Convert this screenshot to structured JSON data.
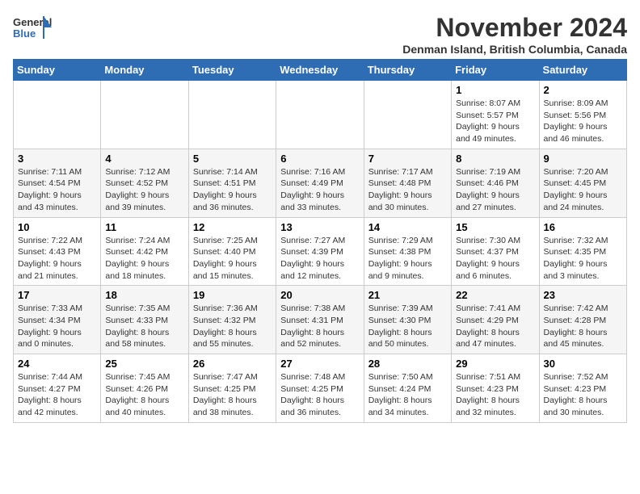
{
  "logo": {
    "line1": "General",
    "line2": "Blue"
  },
  "title": "November 2024",
  "subtitle": "Denman Island, British Columbia, Canada",
  "weekdays": [
    "Sunday",
    "Monday",
    "Tuesday",
    "Wednesday",
    "Thursday",
    "Friday",
    "Saturday"
  ],
  "weeks": [
    [
      {
        "day": "",
        "detail": ""
      },
      {
        "day": "",
        "detail": ""
      },
      {
        "day": "",
        "detail": ""
      },
      {
        "day": "",
        "detail": ""
      },
      {
        "day": "",
        "detail": ""
      },
      {
        "day": "1",
        "detail": "Sunrise: 8:07 AM\nSunset: 5:57 PM\nDaylight: 9 hours and 49 minutes."
      },
      {
        "day": "2",
        "detail": "Sunrise: 8:09 AM\nSunset: 5:56 PM\nDaylight: 9 hours and 46 minutes."
      }
    ],
    [
      {
        "day": "3",
        "detail": "Sunrise: 7:11 AM\nSunset: 4:54 PM\nDaylight: 9 hours and 43 minutes."
      },
      {
        "day": "4",
        "detail": "Sunrise: 7:12 AM\nSunset: 4:52 PM\nDaylight: 9 hours and 39 minutes."
      },
      {
        "day": "5",
        "detail": "Sunrise: 7:14 AM\nSunset: 4:51 PM\nDaylight: 9 hours and 36 minutes."
      },
      {
        "day": "6",
        "detail": "Sunrise: 7:16 AM\nSunset: 4:49 PM\nDaylight: 9 hours and 33 minutes."
      },
      {
        "day": "7",
        "detail": "Sunrise: 7:17 AM\nSunset: 4:48 PM\nDaylight: 9 hours and 30 minutes."
      },
      {
        "day": "8",
        "detail": "Sunrise: 7:19 AM\nSunset: 4:46 PM\nDaylight: 9 hours and 27 minutes."
      },
      {
        "day": "9",
        "detail": "Sunrise: 7:20 AM\nSunset: 4:45 PM\nDaylight: 9 hours and 24 minutes."
      }
    ],
    [
      {
        "day": "10",
        "detail": "Sunrise: 7:22 AM\nSunset: 4:43 PM\nDaylight: 9 hours and 21 minutes."
      },
      {
        "day": "11",
        "detail": "Sunrise: 7:24 AM\nSunset: 4:42 PM\nDaylight: 9 hours and 18 minutes."
      },
      {
        "day": "12",
        "detail": "Sunrise: 7:25 AM\nSunset: 4:40 PM\nDaylight: 9 hours and 15 minutes."
      },
      {
        "day": "13",
        "detail": "Sunrise: 7:27 AM\nSunset: 4:39 PM\nDaylight: 9 hours and 12 minutes."
      },
      {
        "day": "14",
        "detail": "Sunrise: 7:29 AM\nSunset: 4:38 PM\nDaylight: 9 hours and 9 minutes."
      },
      {
        "day": "15",
        "detail": "Sunrise: 7:30 AM\nSunset: 4:37 PM\nDaylight: 9 hours and 6 minutes."
      },
      {
        "day": "16",
        "detail": "Sunrise: 7:32 AM\nSunset: 4:35 PM\nDaylight: 9 hours and 3 minutes."
      }
    ],
    [
      {
        "day": "17",
        "detail": "Sunrise: 7:33 AM\nSunset: 4:34 PM\nDaylight: 9 hours and 0 minutes."
      },
      {
        "day": "18",
        "detail": "Sunrise: 7:35 AM\nSunset: 4:33 PM\nDaylight: 8 hours and 58 minutes."
      },
      {
        "day": "19",
        "detail": "Sunrise: 7:36 AM\nSunset: 4:32 PM\nDaylight: 8 hours and 55 minutes."
      },
      {
        "day": "20",
        "detail": "Sunrise: 7:38 AM\nSunset: 4:31 PM\nDaylight: 8 hours and 52 minutes."
      },
      {
        "day": "21",
        "detail": "Sunrise: 7:39 AM\nSunset: 4:30 PM\nDaylight: 8 hours and 50 minutes."
      },
      {
        "day": "22",
        "detail": "Sunrise: 7:41 AM\nSunset: 4:29 PM\nDaylight: 8 hours and 47 minutes."
      },
      {
        "day": "23",
        "detail": "Sunrise: 7:42 AM\nSunset: 4:28 PM\nDaylight: 8 hours and 45 minutes."
      }
    ],
    [
      {
        "day": "24",
        "detail": "Sunrise: 7:44 AM\nSunset: 4:27 PM\nDaylight: 8 hours and 42 minutes."
      },
      {
        "day": "25",
        "detail": "Sunrise: 7:45 AM\nSunset: 4:26 PM\nDaylight: 8 hours and 40 minutes."
      },
      {
        "day": "26",
        "detail": "Sunrise: 7:47 AM\nSunset: 4:25 PM\nDaylight: 8 hours and 38 minutes."
      },
      {
        "day": "27",
        "detail": "Sunrise: 7:48 AM\nSunset: 4:25 PM\nDaylight: 8 hours and 36 minutes."
      },
      {
        "day": "28",
        "detail": "Sunrise: 7:50 AM\nSunset: 4:24 PM\nDaylight: 8 hours and 34 minutes."
      },
      {
        "day": "29",
        "detail": "Sunrise: 7:51 AM\nSunset: 4:23 PM\nDaylight: 8 hours and 32 minutes."
      },
      {
        "day": "30",
        "detail": "Sunrise: 7:52 AM\nSunset: 4:23 PM\nDaylight: 8 hours and 30 minutes."
      }
    ]
  ]
}
